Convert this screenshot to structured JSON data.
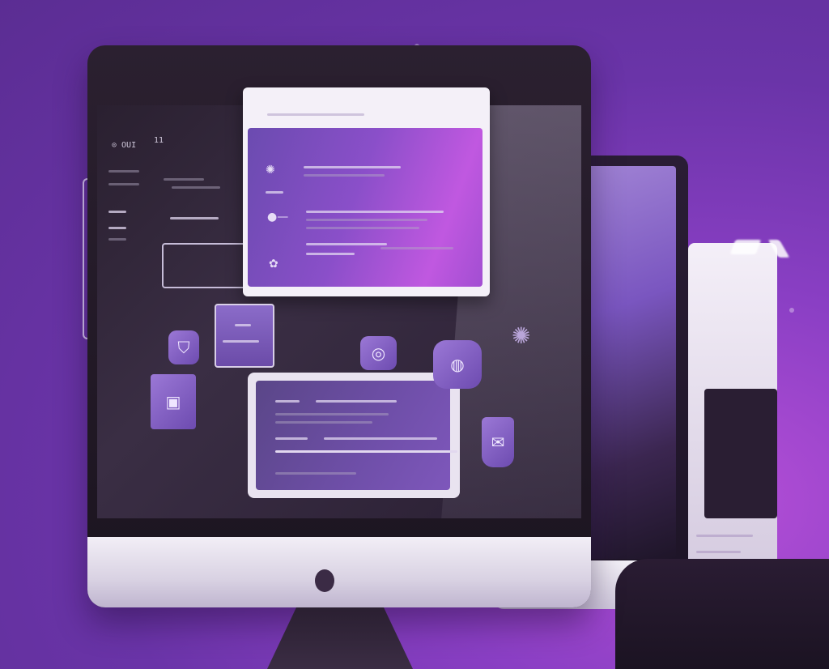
{
  "palette": {
    "background": "#6a34a8",
    "accent": "#c058e0",
    "monitor_bezel": "#1b141f",
    "monitor_chin": "#d9d2e3"
  },
  "screen": {
    "topbar_left": "⊙ OUI",
    "topbar_right": "11"
  },
  "icons": [
    "gear-icon",
    "toggle-icon",
    "bug-icon",
    "shield-icon",
    "coin-icon",
    "image-icon",
    "tag-icon",
    "globe-icon"
  ]
}
